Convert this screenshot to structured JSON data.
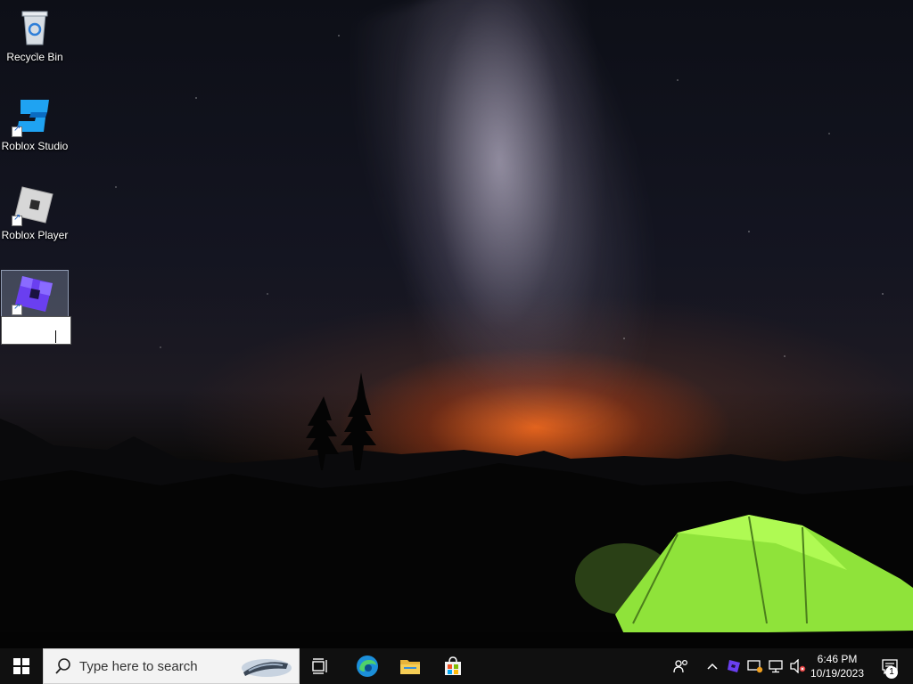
{
  "desktop": {
    "icons": [
      {
        "label": "Recycle Bin",
        "icon": "recycle-bin-icon"
      },
      {
        "label": "Roblox Studio",
        "icon": "roblox-studio-icon"
      },
      {
        "label": "Roblox Player",
        "icon": "roblox-player-icon"
      },
      {
        "label": "",
        "icon": "roblox-app-icon",
        "renaming": true
      }
    ]
  },
  "taskbar": {
    "start_icon": "windows-logo-icon",
    "search": {
      "placeholder": "Type here to search"
    },
    "task_view_icon": "task-view-icon",
    "pinned": [
      {
        "app": "Microsoft Edge",
        "icon": "edge-icon",
        "active": true
      },
      {
        "app": "File Explorer",
        "icon": "folder-icon"
      },
      {
        "app": "Microsoft Store",
        "icon": "store-icon"
      }
    ],
    "tray": {
      "icons": [
        "people-icon",
        "chevron-up-icon",
        "roblox-tray-icon",
        "security-icon",
        "network-icon",
        "volume-muted-icon"
      ],
      "time": "6:46 PM",
      "date": "10/19/2023",
      "notification_count": "1"
    }
  },
  "colors": {
    "taskbar": "#101010",
    "accent": "#0078d7"
  }
}
